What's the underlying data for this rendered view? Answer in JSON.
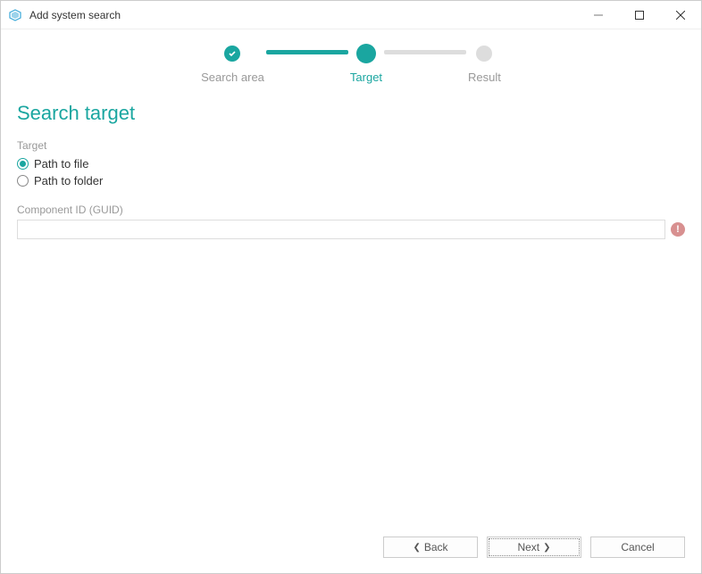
{
  "window": {
    "title": "Add system search"
  },
  "stepper": {
    "steps": [
      {
        "label": "Search area",
        "state": "done"
      },
      {
        "label": "Target",
        "state": "active"
      },
      {
        "label": "Result",
        "state": "future"
      }
    ]
  },
  "page": {
    "heading": "Search target"
  },
  "target": {
    "group_label": "Target",
    "options": [
      {
        "label": "Path to file",
        "selected": true
      },
      {
        "label": "Path to folder",
        "selected": false
      }
    ]
  },
  "component": {
    "label": "Component ID (GUID)",
    "value": "",
    "has_error": true
  },
  "footer": {
    "back": "Back",
    "next": "Next",
    "cancel": "Cancel"
  },
  "colors": {
    "accent": "#1aa6a0",
    "muted": "#999",
    "error_badge": "#d89090"
  }
}
